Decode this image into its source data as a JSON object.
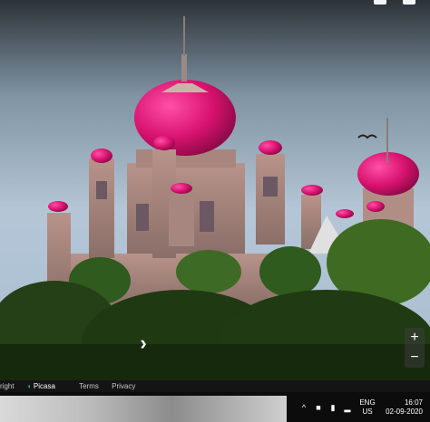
{
  "viewer": {
    "next_arrow": "›",
    "zoom_in": "+",
    "zoom_out": "−"
  },
  "attribution": {
    "copyright": "right",
    "provider": "Picasa",
    "terms": "Terms",
    "privacy": "Privacy"
  },
  "taskbar": {
    "language": "ENG",
    "region": "US",
    "time": "16:07",
    "date": "02-09-2020"
  }
}
